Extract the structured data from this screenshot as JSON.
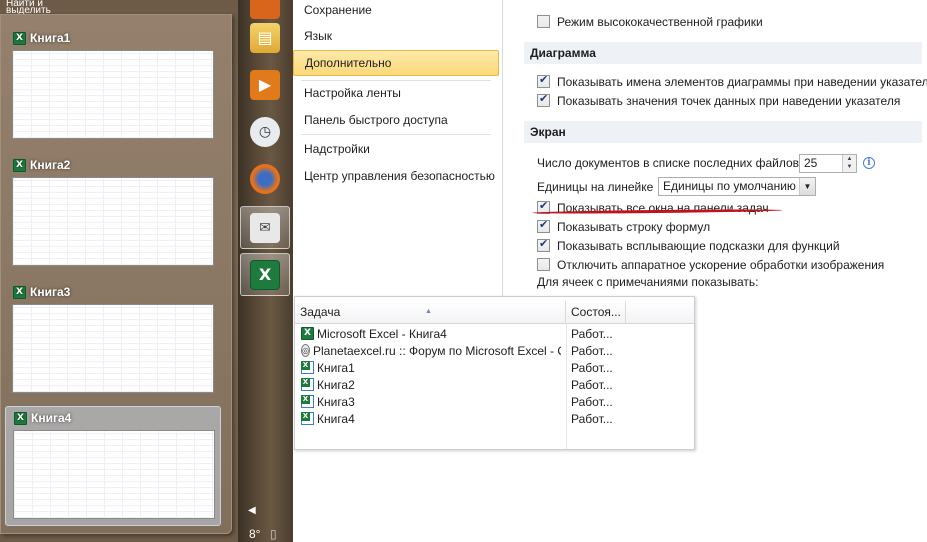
{
  "left_panel": {
    "top_clip": "Найти и выделить",
    "thumbnails": [
      {
        "title": "Книга1",
        "active": false
      },
      {
        "title": "Книга2",
        "active": false
      },
      {
        "title": "Книга3",
        "active": false
      },
      {
        "title": "Книга4",
        "active": true
      }
    ]
  },
  "taskbar": {
    "icons": [
      "file-explorer-icon",
      "media-player-icon",
      "clock-icon",
      "firefox-icon",
      "outlook-icon",
      "excel-icon"
    ],
    "temperature": "8°",
    "scroll_arrow": "◀"
  },
  "options_nav": {
    "items": [
      {
        "label": "Сохранение"
      },
      {
        "label": "Язык"
      },
      {
        "label": "Дополнительно",
        "selected": true
      },
      {
        "label": "Настройка ленты"
      },
      {
        "label": "Панель быстрого доступа"
      },
      {
        "label": "Надстройки"
      },
      {
        "label": "Центр управления безопасностью"
      }
    ]
  },
  "content": {
    "hq_graphics": {
      "label": "Режим высококачественной графики",
      "checked": false
    },
    "chart_section": {
      "title": "Диаграмма",
      "options": [
        {
          "label": "Показывать имена элементов диаграммы при наведении указателя",
          "checked": true
        },
        {
          "label": "Показывать значения точек данных при наведении указателя",
          "checked": true
        }
      ]
    },
    "display_section": {
      "title": "Экран",
      "recent_docs_label": "Число документов в списке последних файлов:",
      "recent_docs_value": "25",
      "ruler_units_label": "Единицы на линейке",
      "ruler_units_value": "Единицы по умолчанию",
      "options": [
        {
          "label": "Показывать все окна на панели задач",
          "checked": true
        },
        {
          "label": "Показывать строку формул",
          "checked": true
        },
        {
          "label": "Показывать всплывающие подсказки для функций",
          "checked": true
        },
        {
          "label": "Отключить аппаратное ускорение обработки изображения",
          "checked": false
        }
      ],
      "comments_label": "Для ячеек с примечаниями показывать:"
    },
    "highlight_color": "#c1121c"
  },
  "task_manager": {
    "columns": {
      "task": "Задача",
      "status": "Состоя..."
    },
    "rows": [
      {
        "name": "Microsoft Excel - Книга4",
        "status": "Работ...",
        "icon": "excel-app-icon"
      },
      {
        "name": "Planetaexcel.ru :: Форум по Microsoft Excel - О...",
        "status": "Работ...",
        "icon": "browser-icon"
      },
      {
        "name": "Книга1",
        "status": "Работ...",
        "icon": "excel-doc-icon"
      },
      {
        "name": "Книга2",
        "status": "Работ...",
        "icon": "excel-doc-icon"
      },
      {
        "name": "Книга3",
        "status": "Работ...",
        "icon": "excel-doc-icon"
      },
      {
        "name": "Книга4",
        "status": "Работ...",
        "icon": "excel-doc-icon"
      }
    ]
  }
}
